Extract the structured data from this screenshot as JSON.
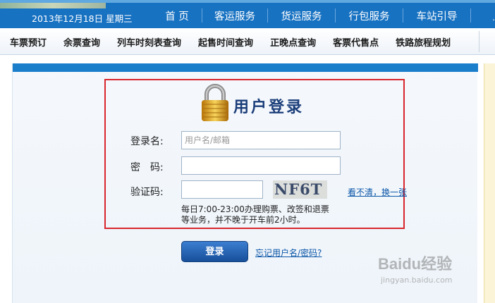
{
  "header": {
    "date": "2013年12月18日 星期三",
    "nav": [
      "首 页",
      "客运服务",
      "货运服务",
      "行包服务",
      "车站引导"
    ],
    "edge": "."
  },
  "subnav": [
    "车票预订",
    "余票查询",
    "列车时刻表查询",
    "起售时间查询",
    "正晚点查询",
    "客票代售点",
    "铁路旅程规划"
  ],
  "login": {
    "title": "用户登录",
    "username_label": "登录名:",
    "username_placeholder": "用户名/邮箱",
    "password_label": "密　码:",
    "password_value": "",
    "captcha_label": "验证码:",
    "captcha_value": "",
    "captcha_text": "NF6T",
    "refresh_link": "看不清，换一张",
    "note": "每日7:00-23:00办理购票、改签和退票等业务，并不晚于开车前2小时。",
    "submit": "登录",
    "forgot": "忘记用户名/密码?"
  },
  "watermark": {
    "brand": "Baidu经验",
    "url": "jingyan.baidu.com"
  },
  "colors": {
    "nav_blue": "#1872c2",
    "accent_red": "#d8262d",
    "button_blue": "#1f5aa8"
  }
}
